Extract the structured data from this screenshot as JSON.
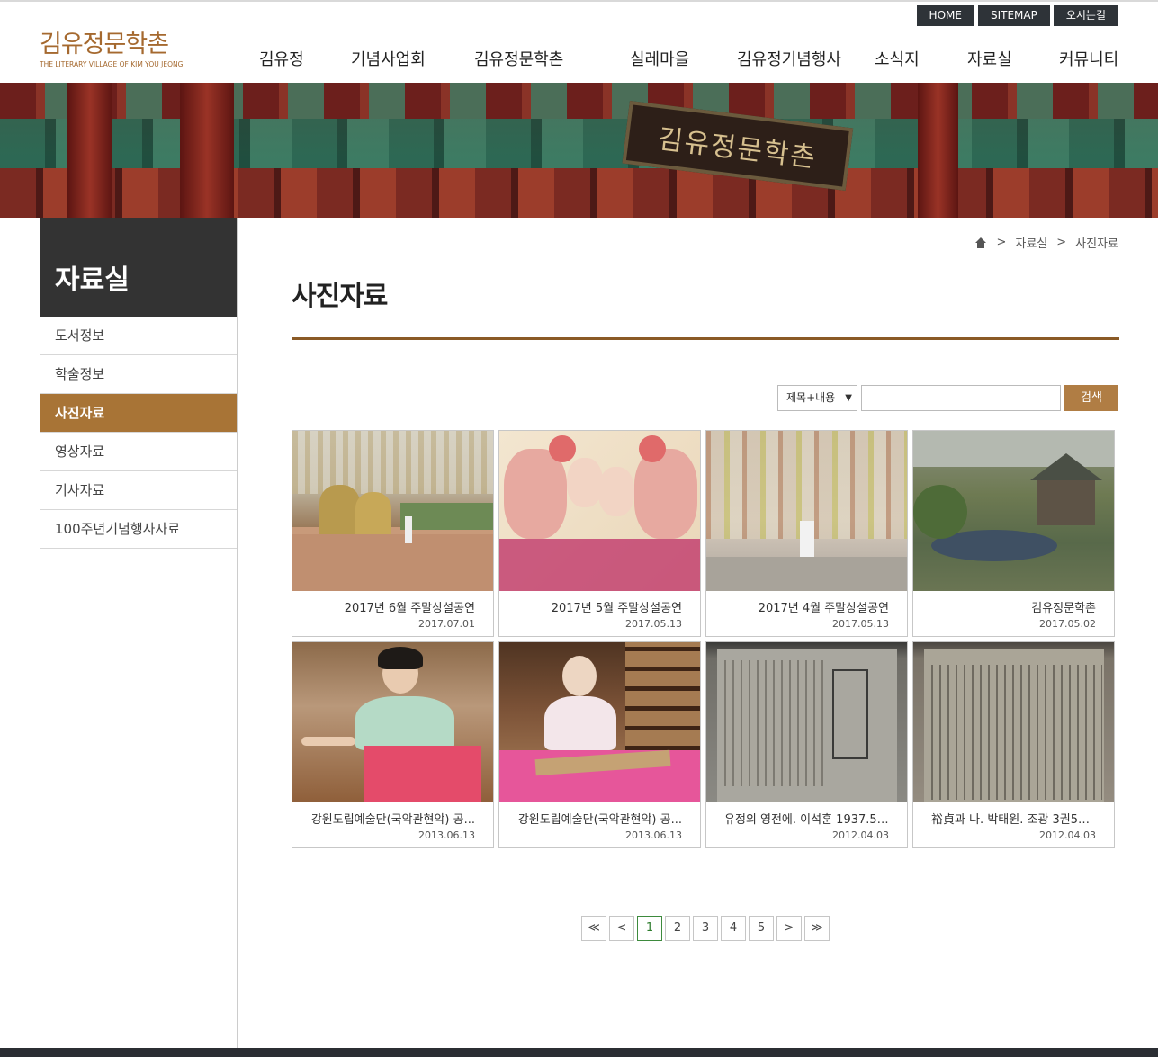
{
  "util": {
    "home": "HOME",
    "sitemap": "SITEMAP",
    "directions": "오시는길"
  },
  "logo": {
    "ko": "김유정문학촌",
    "en": "THE LITERARY VILLAGE OF KIM YOU JEONG"
  },
  "gnb": [
    "김유정",
    "기념사업회",
    "김유정문학촌",
    "실레마을",
    "김유정기념행사",
    "소식지",
    "자료실",
    "커뮤니티"
  ],
  "banner": {
    "sign": "김유정문학촌"
  },
  "lnb": {
    "title": "자료실",
    "items": [
      "도서정보",
      "학술정보",
      "사진자료",
      "영상자료",
      "기사자료",
      "100주년기념행사자료"
    ],
    "active_index": 2
  },
  "breadcrumb": {
    "level1": "자료실",
    "level2": "사진자료",
    "sep": ">"
  },
  "page": {
    "title": "사진자료"
  },
  "search": {
    "option": "제목+내용",
    "arrow": "▼",
    "button": "검색",
    "placeholder": ""
  },
  "gallery": [
    {
      "title": "2017년 6월 주말상설공연",
      "date": "2017.07.01"
    },
    {
      "title": "2017년 5월 주말상설공연",
      "date": "2017.05.13"
    },
    {
      "title": "2017년 4월 주말상설공연",
      "date": "2017.05.13"
    },
    {
      "title": "김유정문학촌",
      "date": "2017.05.02"
    },
    {
      "title": "강원도립예술단(국악관현악) 공...",
      "date": "2013.06.13"
    },
    {
      "title": "강원도립예술단(국악관현악) 공...",
      "date": "2013.06.13"
    },
    {
      "title": "유정의 영전에. 이석훈 1937.5. ...",
      "date": "2012.04.03"
    },
    {
      "title": "裕貞과 나. 박태원. 조광 3권5호 ...",
      "date": "2012.04.03"
    }
  ],
  "pagination": {
    "first": "≪",
    "prev": "<",
    "pages": [
      "1",
      "2",
      "3",
      "4",
      "5"
    ],
    "current": "1",
    "next": ">",
    "last": "≫"
  },
  "colors": {
    "brand": "#a5692f",
    "active_menu": "#a87436",
    "title_rule": "#8a5a26",
    "search_button": "#b07d44",
    "dark": "#333333"
  }
}
